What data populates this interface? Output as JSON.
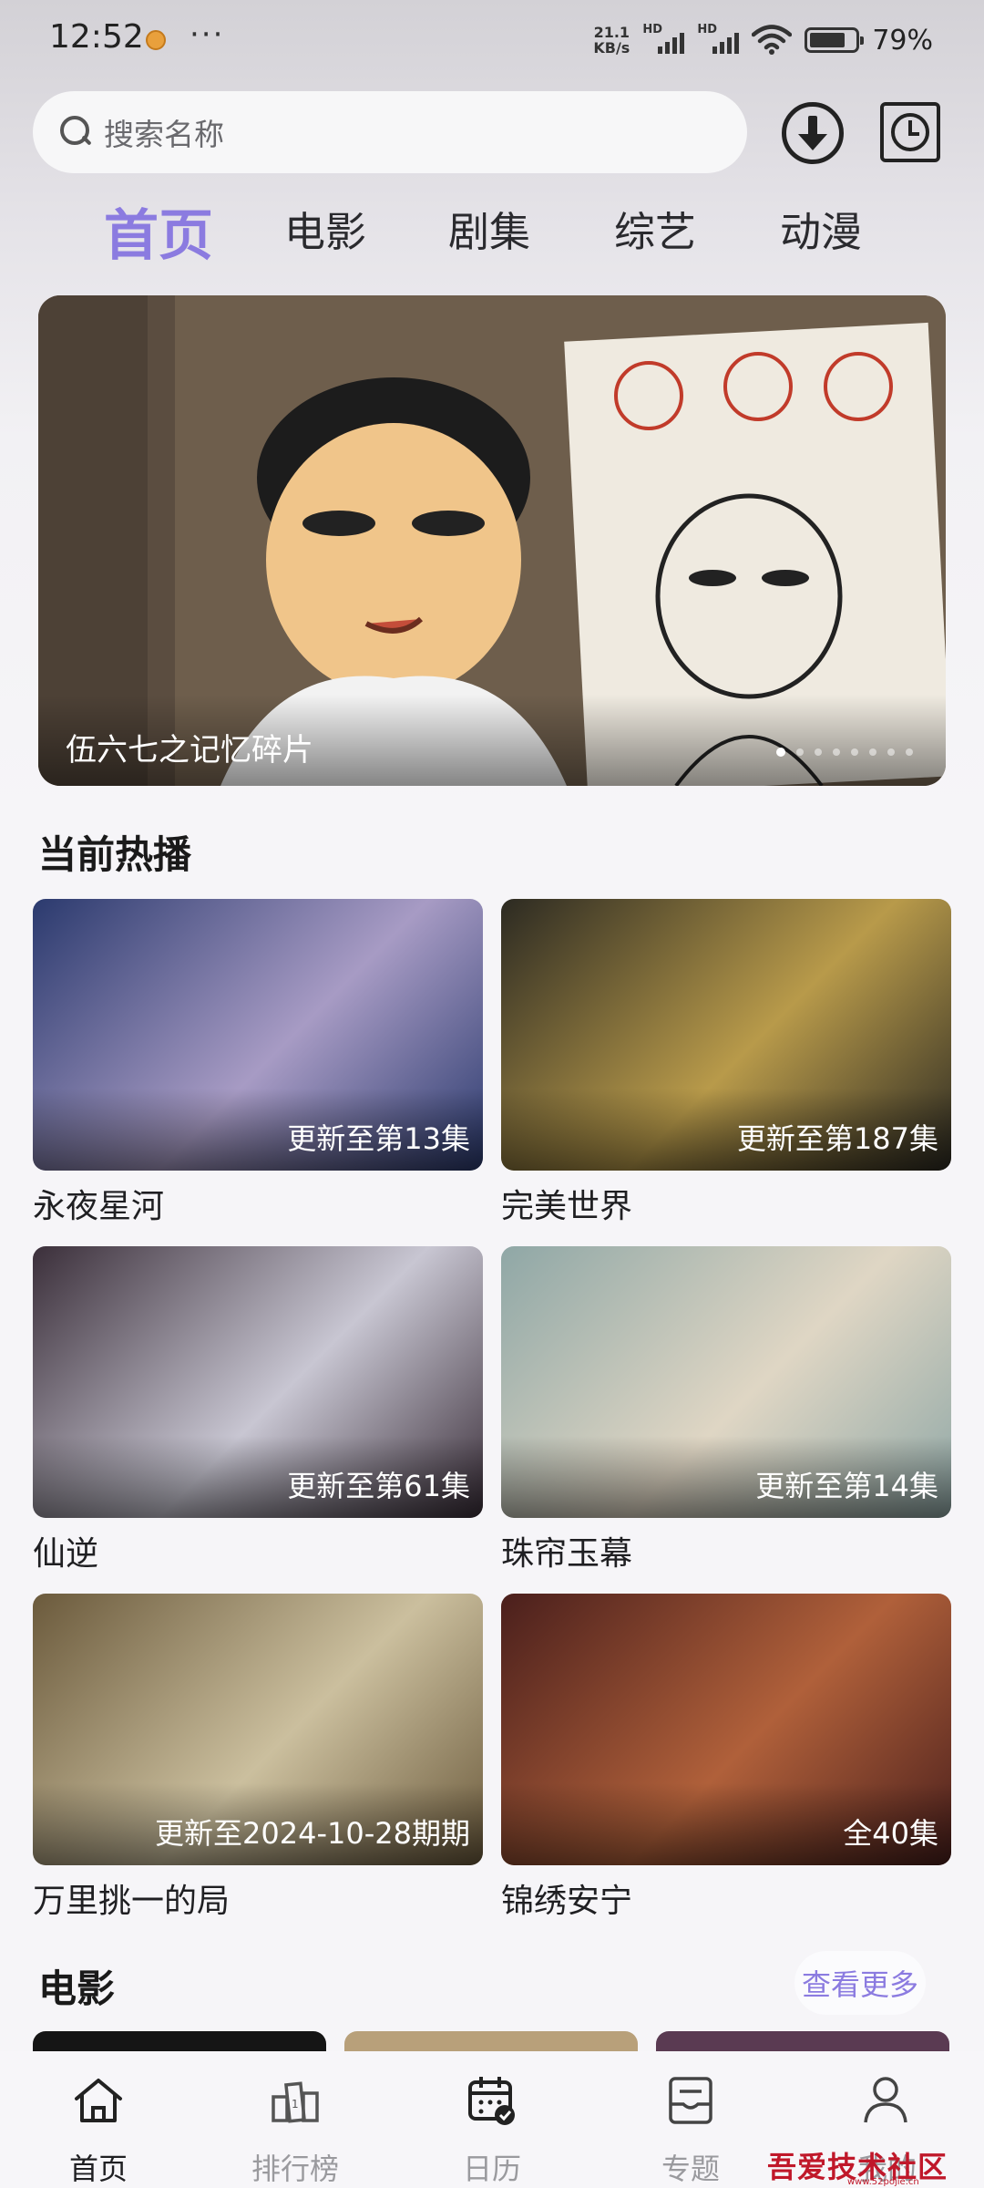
{
  "status_bar": {
    "time": "12:52",
    "more": "···",
    "net_speed_value": "21.1",
    "net_speed_unit": "KB/s",
    "signal_1_label": "HD",
    "signal_2_label": "HD",
    "battery_percent": "79%",
    "battery_level": 0.79
  },
  "search": {
    "placeholder": "搜索名称"
  },
  "tabs": [
    {
      "label": "首页",
      "active": true
    },
    {
      "label": "电影"
    },
    {
      "label": "剧集"
    },
    {
      "label": "综艺"
    },
    {
      "label": "动漫"
    }
  ],
  "banner": {
    "caption": "伍六七之记忆碎片",
    "dot_count": 8,
    "active_dot": 0
  },
  "hot_section": {
    "title": "当前热播",
    "items": [
      {
        "name": "永夜星河",
        "badge": "更新至第13集",
        "color_a": "#2b3a6e",
        "color_b": "#a79bc4"
      },
      {
        "name": "完美世界",
        "badge": "更新至第187集",
        "color_a": "#2c2a22",
        "color_b": "#b89a4a"
      },
      {
        "name": "仙逆",
        "badge": "更新至第61集",
        "color_a": "#3b2f3a",
        "color_b": "#c8c6d2"
      },
      {
        "name": "珠帘玉幕",
        "badge": "更新至第14集",
        "color_a": "#8fa7a6",
        "color_b": "#dfd6c4"
      },
      {
        "name": "万里挑一的局",
        "badge": "更新至2024-10-28期期",
        "color_a": "#6b5a3c",
        "color_b": "#cbbf9e"
      },
      {
        "name": "锦绣安宁",
        "badge": "全40集",
        "color_a": "#4a1f1c",
        "color_b": "#b0603a"
      }
    ]
  },
  "movie_section": {
    "title": "电影",
    "more_label": "查看更多"
  },
  "bottom_nav": [
    {
      "label": "首页",
      "icon": "home-icon",
      "active": true
    },
    {
      "label": "排行榜",
      "icon": "ranking-icon"
    },
    {
      "label": "日历",
      "icon": "calendar-icon"
    },
    {
      "label": "专题",
      "icon": "topic-icon"
    },
    {
      "label": "我的",
      "icon": "profile-icon"
    }
  ],
  "watermark": {
    "text": "吾爱技术社区",
    "sub": "www.52pojie.cn"
  }
}
